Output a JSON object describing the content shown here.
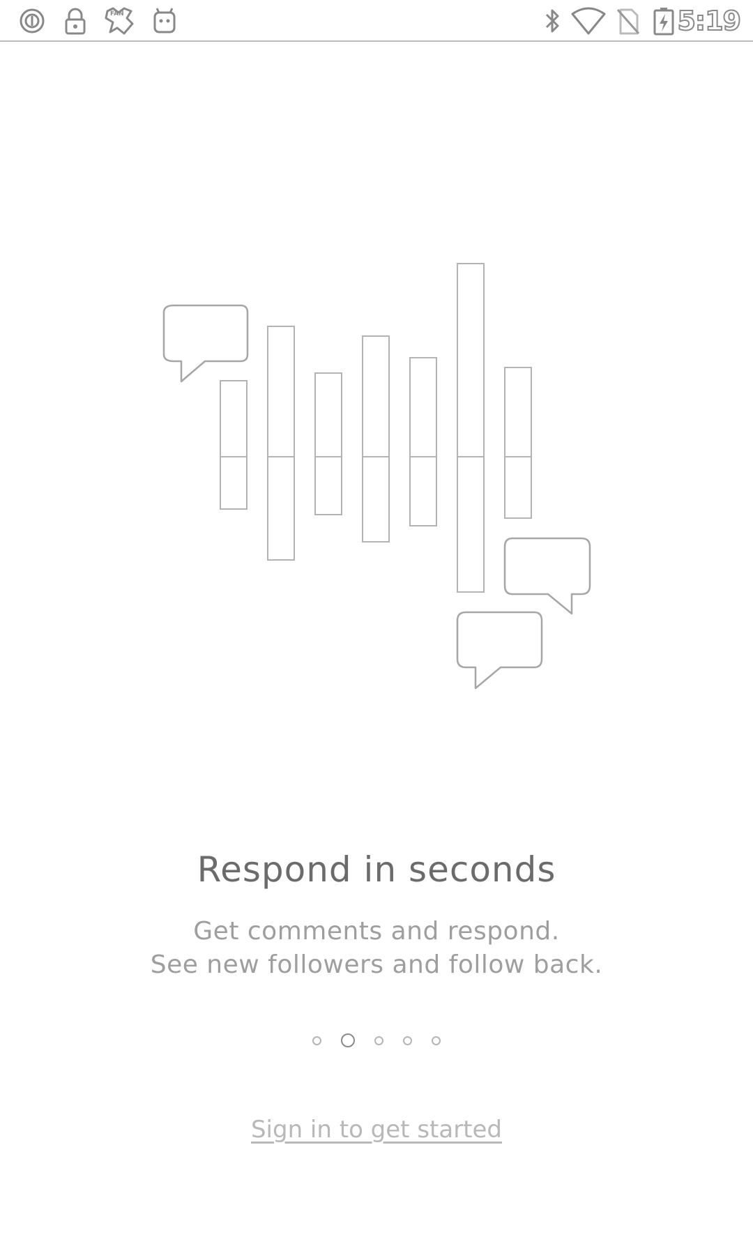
{
  "status_bar": {
    "time": "5:19",
    "left_icons": [
      "notification-circle-icon",
      "lock-icon",
      "fan-app-icon",
      "android-icon"
    ],
    "right_icons": [
      "bluetooth-icon",
      "wifi-icon",
      "no-sim-icon",
      "battery-charging-icon"
    ]
  },
  "onboarding": {
    "title": "Respond in seconds",
    "subtitle_line1": "Get comments and respond.",
    "subtitle_line2": "See new followers and follow back.",
    "pager": {
      "total": 5,
      "active_index": 1
    },
    "signin_link": "Sign in to get started"
  },
  "illustration": {
    "icon": "bar-graph-with-speech-bubbles-illustration"
  }
}
